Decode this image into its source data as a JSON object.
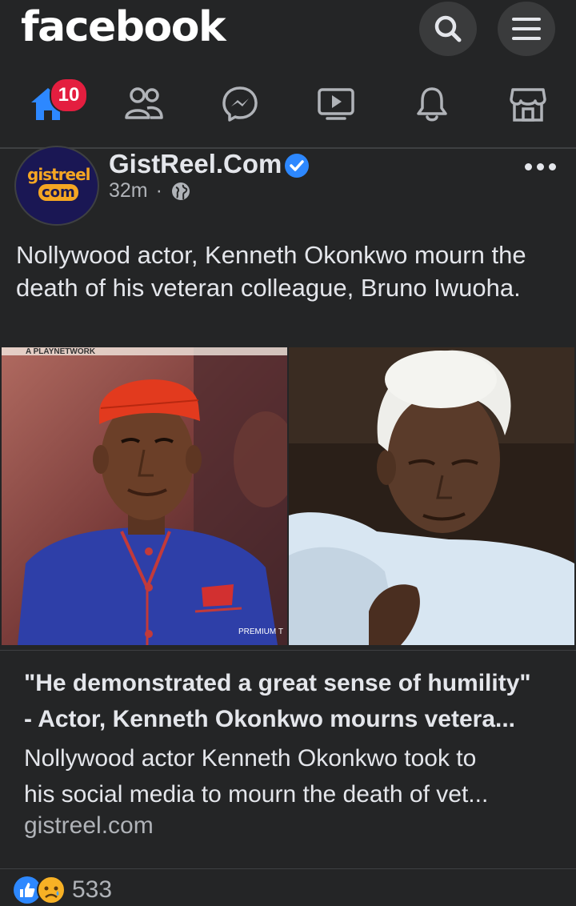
{
  "header": {
    "logo_text": "facebook",
    "search_icon": "search-icon",
    "menu_icon": "hamburger-menu-icon"
  },
  "nav": {
    "items": [
      {
        "name": "home",
        "icon": "home-icon",
        "active": true
      },
      {
        "name": "friends",
        "icon": "friends-icon"
      },
      {
        "name": "messenger",
        "icon": "messenger-icon"
      },
      {
        "name": "watch",
        "icon": "watch-video-icon"
      },
      {
        "name": "notifications",
        "icon": "bell-icon"
      },
      {
        "name": "marketplace",
        "icon": "marketplace-store-icon"
      }
    ],
    "home_badge": "10"
  },
  "post": {
    "avatar_text_top": "gistreel",
    "avatar_text_bottom": "com",
    "page_name": "GistReel.Com",
    "time": "32m",
    "separator": "·",
    "audience_icon": "globe-icon",
    "text": "Nollywood actor, Kenneth Okonkwo mourn the death of his veteran colleague, Bruno Iwuoha.",
    "photo_caption_top": "A PLAYNETWORK",
    "photo_caption_bottom": "PREMIUM T",
    "link": {
      "title_line1": "\"He demonstrated a great sense of humility\"",
      "title_line2": "- Actor, Kenneth Okonkwo mourns vetera...",
      "desc_line1": "Nollywood actor Kenneth Okonkwo took to",
      "desc_line2": "his social media to mourn the death of vet...",
      "domain": "gistreel.com"
    },
    "reaction_count": "533"
  },
  "colors": {
    "background": "#242526",
    "accent": "#2d88ff",
    "badge": "#e41e3f",
    "text": "#e4e6eb",
    "muted": "#b0b3b8"
  }
}
